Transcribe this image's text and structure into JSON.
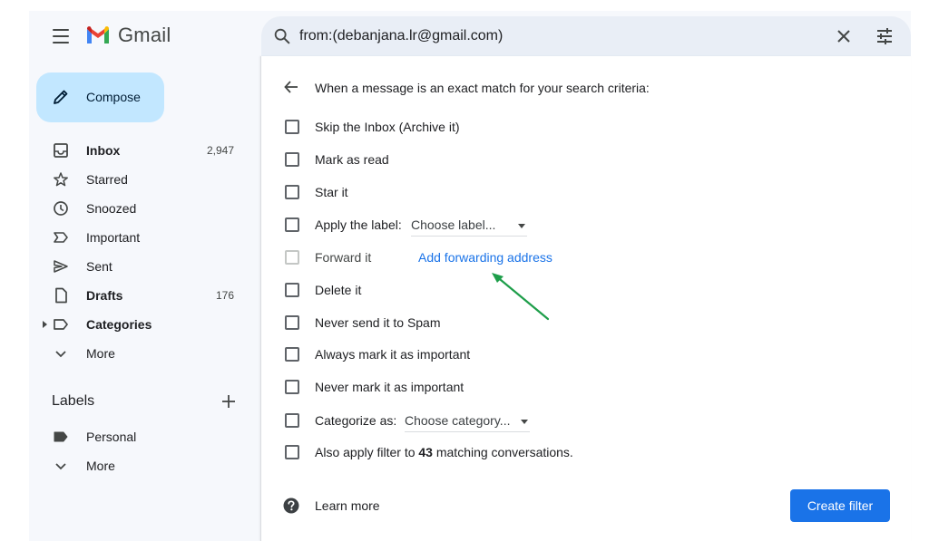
{
  "header": {
    "app_name": "Gmail",
    "search_value": "from:(debanjana.lr@gmail.com)"
  },
  "compose": {
    "label": "Compose"
  },
  "nav": {
    "items": [
      {
        "label": "Inbox",
        "count": "2,947",
        "icon": "inbox-icon",
        "bold": true
      },
      {
        "label": "Starred",
        "count": "",
        "icon": "star-icon",
        "bold": false
      },
      {
        "label": "Snoozed",
        "count": "",
        "icon": "clock-icon",
        "bold": false
      },
      {
        "label": "Important",
        "count": "",
        "icon": "important-icon",
        "bold": false
      },
      {
        "label": "Sent",
        "count": "",
        "icon": "send-icon",
        "bold": false
      },
      {
        "label": "Drafts",
        "count": "176",
        "icon": "draft-icon",
        "bold": true
      },
      {
        "label": "Categories",
        "count": "",
        "icon": "label-outline-icon",
        "bold": true
      },
      {
        "label": "More",
        "count": "",
        "icon": "chevron-down-icon",
        "bold": false
      }
    ]
  },
  "labels": {
    "title": "Labels",
    "items": [
      {
        "label": "Personal",
        "icon": "label-icon"
      },
      {
        "label": "More",
        "icon": "chevron-down-icon"
      }
    ]
  },
  "filter": {
    "criteria_text": "When a message is an exact match for your search criteria:",
    "options": {
      "skip_inbox": "Skip the Inbox (Archive it)",
      "mark_read": "Mark as read",
      "star": "Star it",
      "apply_label": "Apply the label:",
      "apply_label_dropdown": "Choose label...",
      "forward": "Forward it",
      "forward_link": "Add forwarding address",
      "delete": "Delete it",
      "never_spam": "Never send it to Spam",
      "always_important": "Always mark it as important",
      "never_important": "Never mark it as important",
      "categorize": "Categorize as:",
      "categorize_dropdown": "Choose category...",
      "also_apply_prefix": "Also apply filter to ",
      "also_apply_count": "43",
      "also_apply_suffix": " matching conversations."
    },
    "learn_more": "Learn more",
    "create_button": "Create filter"
  },
  "colors": {
    "accent": "#1a73e8",
    "compose_bg": "#c2e7ff",
    "annotation_arrow": "#1e9e4a"
  }
}
